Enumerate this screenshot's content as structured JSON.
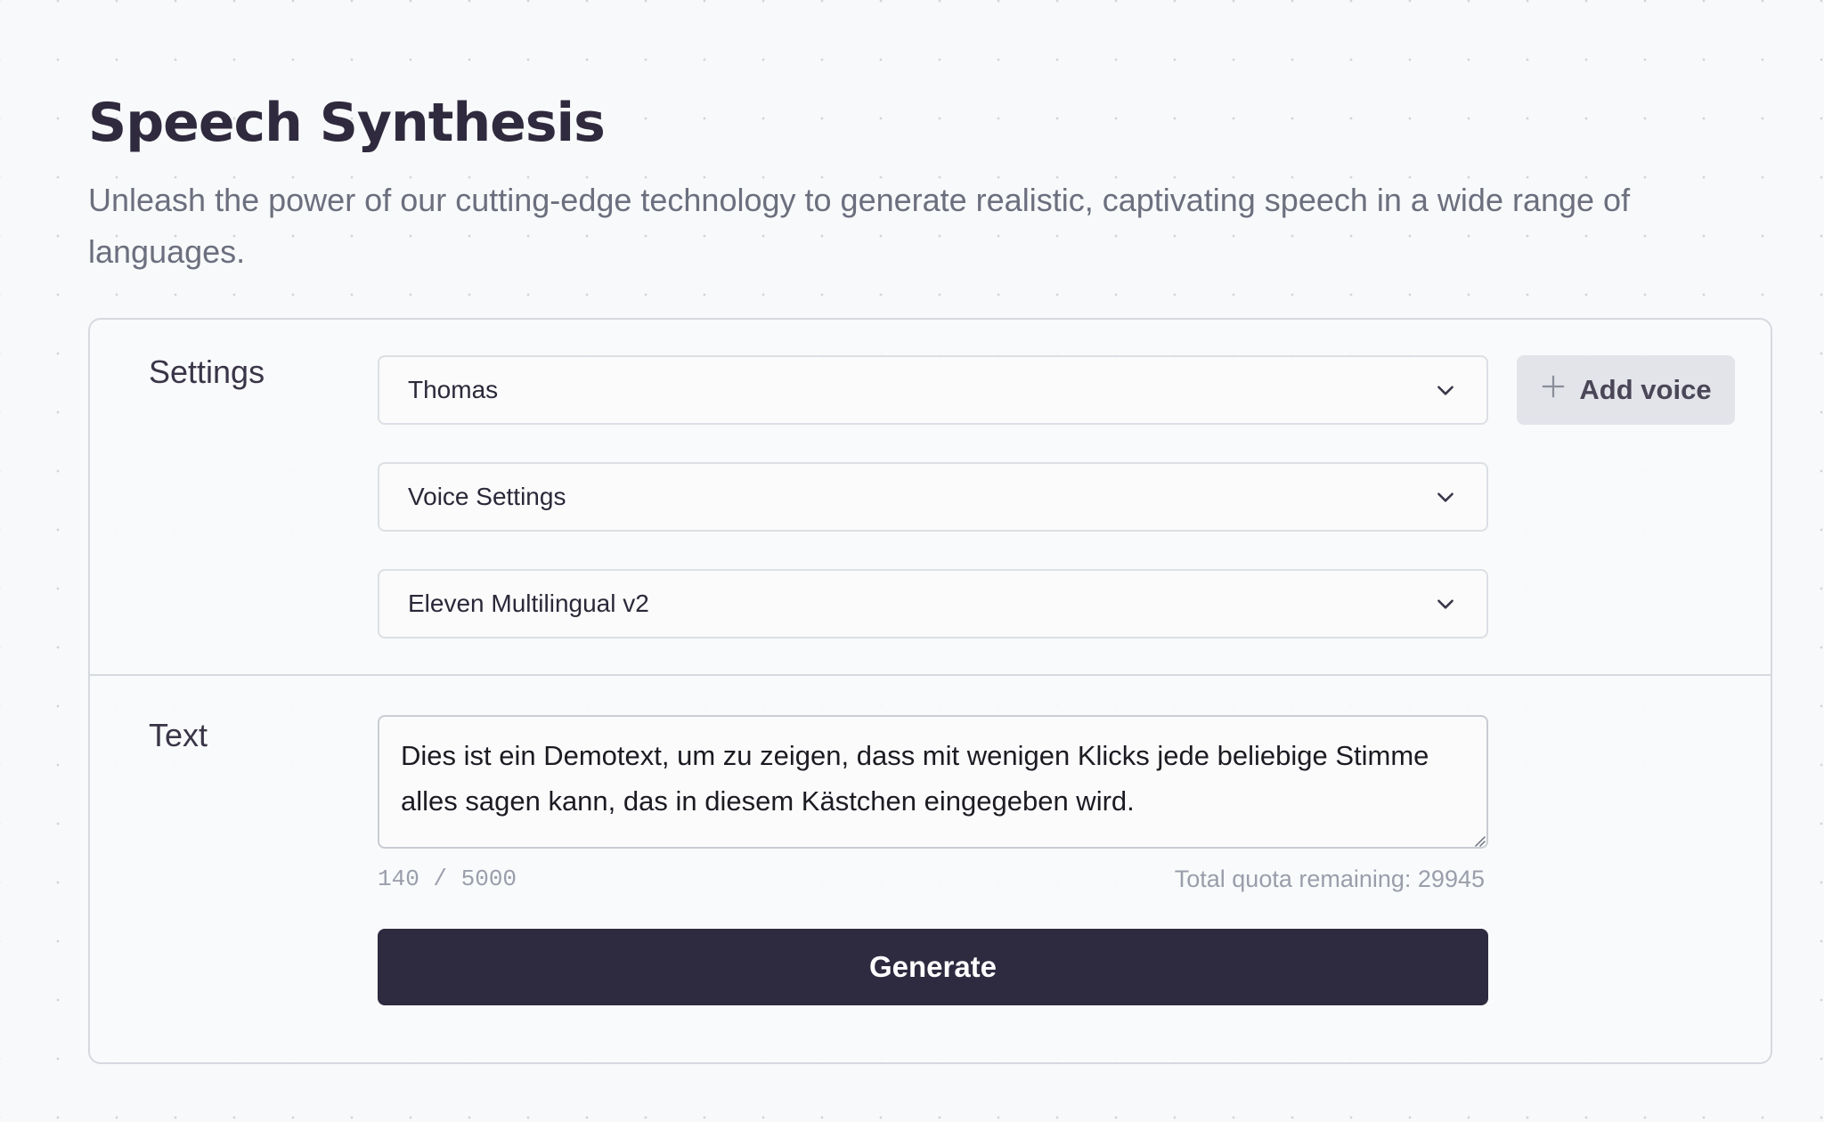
{
  "header": {
    "title": "Speech Synthesis",
    "subtitle": "Unleash the power of our cutting-edge technology to generate realistic, captivating speech in a wide range of languages."
  },
  "settings": {
    "label": "Settings",
    "voice": {
      "selected": "Thomas",
      "icon": "chevron-down-icon"
    },
    "voice_settings": {
      "selected": "Voice Settings",
      "icon": "chevron-down-icon"
    },
    "model": {
      "selected": "Eleven Multilingual v2",
      "icon": "chevron-down-icon"
    },
    "add_voice_label": "Add voice",
    "add_voice_icon": "plus-icon"
  },
  "text_section": {
    "label": "Text",
    "value": "Dies ist ein Demotext, um zu zeigen, dass mit wenigen Klicks jede beliebige Stimme alles sagen kann, das in diesem Kästchen eingegeben wird.",
    "char_count": "140 / 5000",
    "quota": "Total quota remaining: 29945"
  },
  "generate_label": "Generate",
  "colors": {
    "primary_button": "#2e2a3f",
    "secondary_button": "#e2e4ea",
    "border": "#d6d9df",
    "muted_text": "#6b6f7e"
  }
}
